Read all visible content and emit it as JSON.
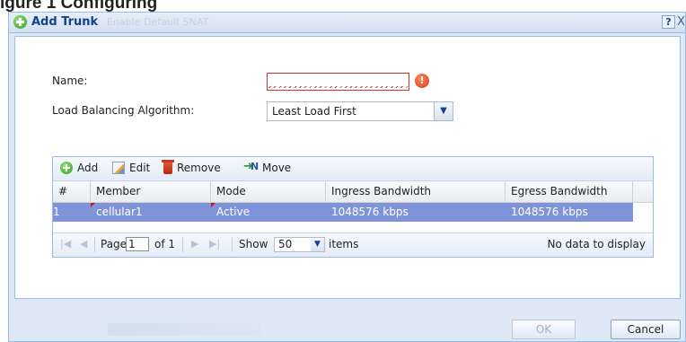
{
  "figure": {
    "label": "igure 1 Configuring"
  },
  "dialog": {
    "title": "Add Trunk",
    "ghost_text": "Enable Default SNAT",
    "help_label": "?",
    "close_label": "X",
    "name_label": "Name:",
    "name_value": "",
    "error_icon": "!",
    "algorithm_label": "Load Balancing Algorithm:",
    "algorithm_value": "Least Load First",
    "ok_label": "OK",
    "cancel_label": "Cancel"
  },
  "toolbar": {
    "add_label": "Add",
    "edit_label": "Edit",
    "remove_label": "Remove",
    "move_label": "Move"
  },
  "table": {
    "columns": [
      "#",
      "Member",
      "Mode",
      "Ingress Bandwidth",
      "Egress Bandwidth"
    ],
    "rows": [
      {
        "index": "1",
        "member": "cellular1",
        "mode": "Active",
        "ingress": "1048576 kbps",
        "egress": "1048576 kbps",
        "selected": true
      }
    ]
  },
  "pager": {
    "page_label": "Page",
    "page_value": "1",
    "of_label": "of 1",
    "show_label": "Show",
    "show_value": "50",
    "items_label": "items",
    "status": "No data to display"
  },
  "colors": {
    "selected_row": "#7f93d8",
    "title_text": "#15428b",
    "error": "#cc3333"
  }
}
